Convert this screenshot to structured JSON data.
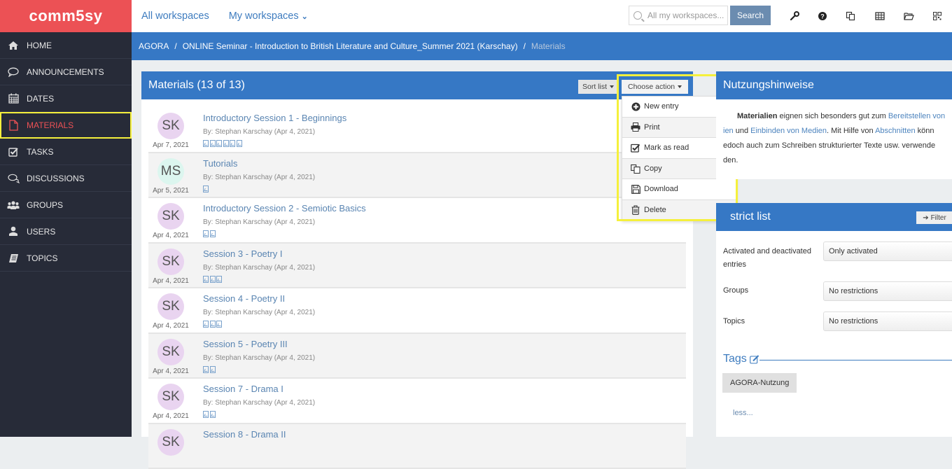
{
  "brand": {
    "logo_text": "comm5sy",
    "color": "#ec5155"
  },
  "topbar": {
    "nav": [
      {
        "label": "All workspaces"
      },
      {
        "label": "My workspaces",
        "has_dropdown": true
      }
    ],
    "search": {
      "placeholder": "All my workspaces...",
      "button": "Search"
    },
    "icons": [
      "wrench-icon",
      "help-icon",
      "copy-icon",
      "table-icon",
      "folder-open-icon",
      "qr-code-icon"
    ]
  },
  "sidebar": {
    "items": [
      {
        "label": "HOME",
        "icon": "home-icon"
      },
      {
        "label": "ANNOUNCEMENTS",
        "icon": "speech-bubble-icon"
      },
      {
        "label": "DATES",
        "icon": "calendar-icon"
      },
      {
        "label": "MATERIALS",
        "icon": "document-icon",
        "active": true
      },
      {
        "label": "TASKS",
        "icon": "checkbox-icon"
      },
      {
        "label": "DISCUSSIONS",
        "icon": "discussion-icon"
      },
      {
        "label": "GROUPS",
        "icon": "groups-icon"
      },
      {
        "label": "USERS",
        "icon": "user-icon"
      },
      {
        "label": "TOPICS",
        "icon": "book-icon"
      }
    ]
  },
  "breadcrumb": {
    "items": [
      "AGORA",
      "ONLINE Seminar - Introduction to British Literature and Culture_Summer 2021 (Karschay)",
      "Materials"
    ],
    "separator": "/"
  },
  "materials": {
    "title": "Materials (13 of 13)",
    "sort_label": "Sort list",
    "action_label": "Choose action",
    "rows": [
      {
        "initials": "SK",
        "date": "Apr 7, 2021",
        "title": "Introductory Session 1 - Beginnings",
        "by": "By: Stephan Karschay (Apr 4, 2021)",
        "files": 6
      },
      {
        "initials": "MS",
        "date": "Apr 5, 2021",
        "title": "Tutorials",
        "by": "By: Stephan Karschay (Apr 4, 2021)",
        "files": 1
      },
      {
        "initials": "SK",
        "date": "Apr 4, 2021",
        "title": "Introductory Session 2 - Semiotic Basics",
        "by": "By: Stephan Karschay (Apr 4, 2021)",
        "files": 2
      },
      {
        "initials": "SK",
        "date": "Apr 4, 2021",
        "title": "Session 3 - Poetry I",
        "by": "By: Stephan Karschay (Apr 4, 2021)",
        "files": 3
      },
      {
        "initials": "SK",
        "date": "Apr 4, 2021",
        "title": "Session 4 - Poetry II",
        "by": "By: Stephan Karschay (Apr 4, 2021)",
        "files": 3
      },
      {
        "initials": "SK",
        "date": "Apr 4, 2021",
        "title": "Session 5 - Poetry III",
        "by": "By: Stephan Karschay (Apr 4, 2021)",
        "files": 2
      },
      {
        "initials": "SK",
        "date": "Apr 4, 2021",
        "title": "Session 7 - Drama I",
        "by": "By: Stephan Karschay (Apr 4, 2021)",
        "files": 2
      },
      {
        "initials": "SK",
        "date": "",
        "title": "Session 8 - Drama II",
        "by": "",
        "files": 0
      }
    ]
  },
  "action_menu": {
    "items": [
      {
        "label": "New entry",
        "icon": "plus-circle-icon"
      },
      {
        "label": "Print",
        "icon": "printer-icon"
      },
      {
        "label": "Mark as read",
        "icon": "check-square-icon"
      },
      {
        "label": "Copy",
        "icon": "copy-icon"
      },
      {
        "label": "Download",
        "icon": "save-icon"
      },
      {
        "label": "Delete",
        "icon": "trash-icon"
      }
    ]
  },
  "info": {
    "title": "Nutzungshinweise",
    "line1_bold": "Materialien",
    "line1_text": " eignen sich besonders gut zum ",
    "line1_link": "Bereitstellen von",
    "line2_link1": "ien",
    "line2_text1": " und ",
    "line2_link2": "Einbinden von Medien",
    "line2_text2": ". Mit Hilfe von ",
    "line2_link3": "Abschnitten",
    "line2_text3": " könn",
    "line3": "edoch auch zum Schreiben strukturierter Texte usw. verwende",
    "line4": "den."
  },
  "restrict": {
    "title": "strict list",
    "filter_label": "Filter",
    "filters": [
      {
        "label": "Activated and deactivated entries",
        "value": "Only activated"
      },
      {
        "label": "Groups",
        "value": "No restrictions"
      },
      {
        "label": "Topics",
        "value": "No restrictions"
      }
    ],
    "tags_title": "Tags",
    "tags": [
      "AGORA-Nutzung"
    ],
    "less_label": "less..."
  }
}
